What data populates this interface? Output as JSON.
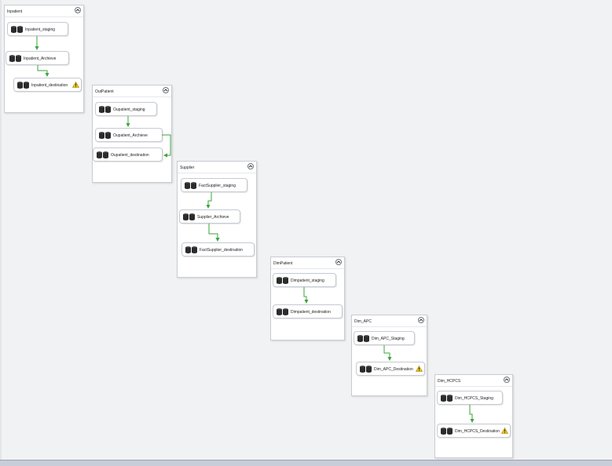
{
  "containers": {
    "inpatient": {
      "title": "Inpatient",
      "tasks": [
        "Inpatient_staging",
        "Inpatient_Archieve",
        "Inpatient_destination"
      ]
    },
    "outpatient": {
      "title": "OutPatient",
      "tasks": [
        "Oupatient_staging",
        "Oupatient_Archieve",
        "Oupatient_destination"
      ]
    },
    "supplier": {
      "title": "Supplier",
      "tasks": [
        "FactSupplier_staging",
        "Supplier_Archieve",
        "FactSupplier_destination"
      ]
    },
    "dimpatient": {
      "title": "DimPatient",
      "tasks": [
        "Dimpatient_staging",
        "Dimpatient_destination"
      ]
    },
    "dim_apc": {
      "title": "Dim_APC",
      "tasks": [
        "Dim_APC_Staging",
        "Dim_APC_Destination"
      ]
    },
    "dim_hcpcs": {
      "title": "Dim_HCPCS",
      "tasks": [
        "Dim_HCPCS_Staging",
        "Dim_HCPCS_Destination"
      ]
    }
  },
  "icons": {
    "task": "data-flow-task-icon",
    "warning": "warning-icon",
    "collapse": "chevron-up-icon"
  },
  "colors": {
    "canvas": "#f1f2f4",
    "precedence_arrow": "#3aa53a",
    "warning": "#f0c419"
  }
}
